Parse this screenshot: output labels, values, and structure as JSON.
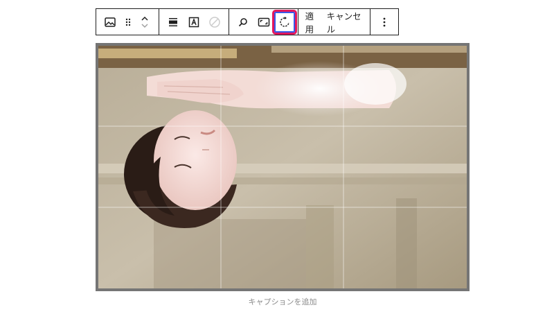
{
  "toolbar": {
    "apply_label": "適用",
    "cancel_label": "キャンセル",
    "icons": [
      "image-icon",
      "drag-handle-icon",
      "move-up-icon",
      "move-down-icon",
      "align-wide-icon",
      "alt-text-icon",
      "link-disabled-icon",
      "zoom-icon",
      "aspect-ratio-icon",
      "rotate-icon",
      "more-options-icon"
    ],
    "highlight_color": "#e3175c",
    "active_border_color": "#3858e9"
  },
  "caption": {
    "placeholder": "キャプションを追加"
  }
}
